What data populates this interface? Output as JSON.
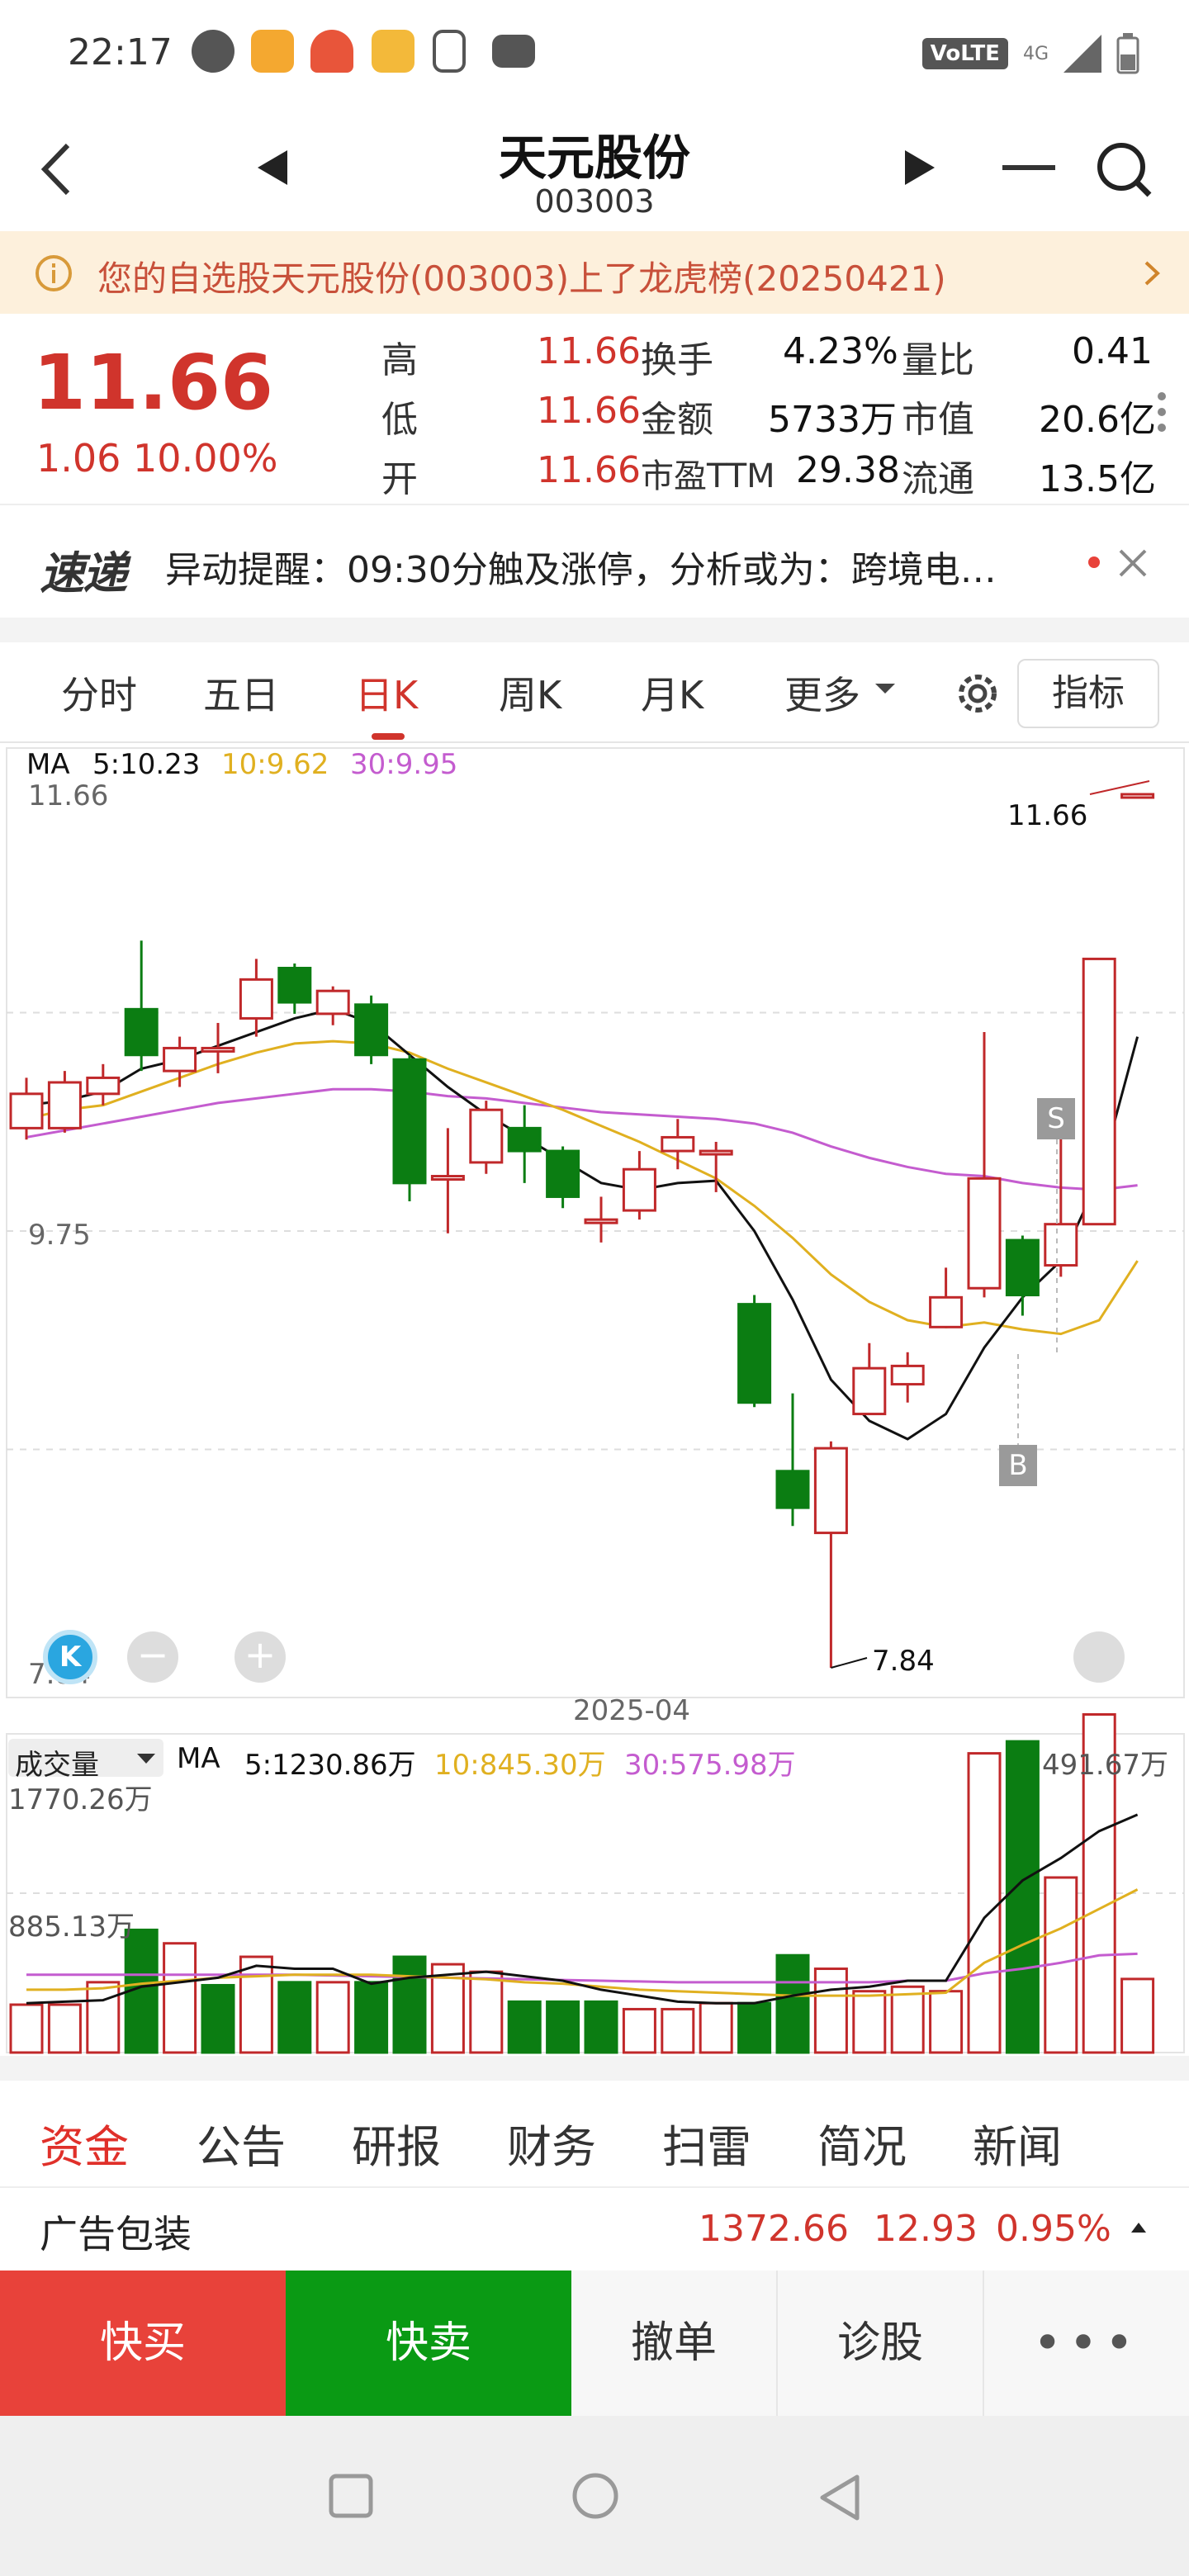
{
  "status_bar": {
    "time": "22:17",
    "network": "4G",
    "volte": "VoLTE"
  },
  "header": {
    "title": "天元股份",
    "code": "003003"
  },
  "notice": {
    "text": "您的自选股天元股份(003003)上了龙虎榜(20250421)"
  },
  "quote": {
    "price": "11.66",
    "change": "1.06  10.00%",
    "cells": [
      {
        "label": "高",
        "value": "11.66"
      },
      {
        "label": "低",
        "value": "11.66"
      },
      {
        "label": "开",
        "value": "11.66"
      },
      {
        "label": "换手",
        "value": "4.23%"
      },
      {
        "label": "金额",
        "value": "5733万"
      },
      {
        "label": "市盈TTM",
        "value": "29.38"
      },
      {
        "label": "量比",
        "value": "0.41"
      },
      {
        "label": "市值",
        "value": "20.6亿"
      },
      {
        "label": "流通",
        "value": "13.5亿"
      }
    ]
  },
  "alert": {
    "logo": "速递",
    "message": "异动提醒：09:30分触及涨停，分析或为：跨境电…"
  },
  "tabs": [
    {
      "label": "分时"
    },
    {
      "label": "五日"
    },
    {
      "label": "日K"
    },
    {
      "label": "周K"
    },
    {
      "label": "月K"
    },
    {
      "label": "更多"
    }
  ],
  "indicator_button": "指标",
  "kline": {
    "ma_label": "MA",
    "ma5": "5:10.23",
    "ma10": "10:9.62",
    "ma30": "30:9.95",
    "y_top": "11.66",
    "y_mid": "9.75",
    "y_bottom": "7.84",
    "high_marker": "11.66",
    "low_marker": "7.84",
    "date_label": "2025-04",
    "sell_tag": "S",
    "buy_tag": "B",
    "colors": {
      "up": "#c0282a",
      "down": "#0b7d12",
      "ma5": "#111111",
      "ma10": "#e0b020",
      "ma30": "#c45ccf"
    }
  },
  "volume": {
    "label": "成交量",
    "ma_label": "MA",
    "ma5": "5:1230.86万",
    "ma10": "10:845.30万",
    "ma30": "30:575.98万",
    "last": "491.67万",
    "y_top": "1770.26万",
    "y_mid": "885.13万"
  },
  "bottom_tabs": [
    {
      "label": "资金"
    },
    {
      "label": "公告"
    },
    {
      "label": "研报"
    },
    {
      "label": "财务"
    },
    {
      "label": "扫雷"
    },
    {
      "label": "简况"
    },
    {
      "label": "新闻"
    }
  ],
  "sector": {
    "name": "广告包装",
    "index": "1372.66",
    "change": "12.93",
    "pct": "0.95%"
  },
  "actions": {
    "buy": "快买",
    "sell": "快卖",
    "cancel": "撤单",
    "diagnose": "诊股",
    "more": "•••"
  },
  "chart_data": {
    "type": "candlestick",
    "price_range": [
      7.84,
      11.66
    ],
    "candles": [
      {
        "o": 10.2,
        "c": 10.35,
        "h": 10.42,
        "l": 10.15
      },
      {
        "o": 10.2,
        "c": 10.4,
        "h": 10.45,
        "l": 10.18
      },
      {
        "o": 10.35,
        "c": 10.42,
        "h": 10.48,
        "l": 10.3
      },
      {
        "o": 10.72,
        "c": 10.52,
        "h": 11.02,
        "l": 10.45
      },
      {
        "o": 10.45,
        "c": 10.55,
        "h": 10.6,
        "l": 10.38
      },
      {
        "o": 10.55,
        "c": 10.55,
        "h": 10.66,
        "l": 10.44
      },
      {
        "o": 10.68,
        "c": 10.85,
        "h": 10.94,
        "l": 10.6
      },
      {
        "o": 10.9,
        "c": 10.75,
        "h": 10.92,
        "l": 10.7
      },
      {
        "o": 10.7,
        "c": 10.8,
        "h": 10.82,
        "l": 10.65
      },
      {
        "o": 10.74,
        "c": 10.52,
        "h": 10.78,
        "l": 10.48
      },
      {
        "o": 10.5,
        "c": 9.96,
        "h": 10.52,
        "l": 9.88
      },
      {
        "o": 9.98,
        "c": 9.99,
        "h": 10.2,
        "l": 9.74
      },
      {
        "o": 10.05,
        "c": 10.28,
        "h": 10.32,
        "l": 10.0
      },
      {
        "o": 10.2,
        "c": 10.1,
        "h": 10.3,
        "l": 9.96
      },
      {
        "o": 10.1,
        "c": 9.9,
        "h": 10.12,
        "l": 9.85
      },
      {
        "o": 9.8,
        "c": 9.8,
        "h": 9.9,
        "l": 9.7
      },
      {
        "o": 9.84,
        "c": 10.02,
        "h": 10.1,
        "l": 9.8
      },
      {
        "o": 10.1,
        "c": 10.16,
        "h": 10.24,
        "l": 10.02
      },
      {
        "o": 10.1,
        "c": 10.1,
        "h": 10.14,
        "l": 9.92
      },
      {
        "o": 9.43,
        "c": 9.0,
        "h": 9.47,
        "l": 8.98
      },
      {
        "o": 8.7,
        "c": 8.54,
        "h": 9.04,
        "l": 8.46
      },
      {
        "o": 8.43,
        "c": 8.8,
        "h": 8.83,
        "l": 7.84
      },
      {
        "o": 8.95,
        "c": 9.15,
        "h": 9.26,
        "l": 8.95
      },
      {
        "o": 9.08,
        "c": 9.16,
        "h": 9.22,
        "l": 9.0
      },
      {
        "o": 9.33,
        "c": 9.46,
        "h": 9.59,
        "l": 9.33
      },
      {
        "o": 9.5,
        "c": 9.98,
        "h": 10.62,
        "l": 9.46
      },
      {
        "o": 9.71,
        "c": 9.47,
        "h": 9.73,
        "l": 9.38
      },
      {
        "o": 9.6,
        "c": 9.78,
        "h": 10.18,
        "l": 9.55
      },
      {
        "o": 9.78,
        "c": 10.94,
        "h": 10.94,
        "l": 9.78
      },
      {
        "o": 11.66,
        "c": 11.66,
        "h": 11.66,
        "l": 11.66
      }
    ],
    "ma5": [
      10.3,
      10.32,
      10.36,
      10.46,
      10.5,
      10.56,
      10.62,
      10.68,
      10.72,
      10.66,
      10.52,
      10.38,
      10.26,
      10.16,
      10.06,
      9.96,
      9.93,
      9.96,
      9.97,
      9.75,
      9.45,
      9.1,
      8.92,
      8.84,
      8.95,
      9.24,
      9.46,
      9.62,
      9.98,
      10.6
    ],
    "ma10": [
      10.24,
      10.28,
      10.3,
      10.36,
      10.42,
      10.48,
      10.53,
      10.57,
      10.58,
      10.57,
      10.53,
      10.46,
      10.4,
      10.34,
      10.28,
      10.21,
      10.14,
      10.06,
      9.98,
      9.86,
      9.72,
      9.56,
      9.44,
      9.36,
      9.33,
      9.35,
      9.32,
      9.3,
      9.36,
      9.62
    ],
    "ma30": [
      10.16,
      10.19,
      10.22,
      10.25,
      10.28,
      10.31,
      10.33,
      10.35,
      10.37,
      10.37,
      10.36,
      10.34,
      10.33,
      10.31,
      10.29,
      10.27,
      10.26,
      10.25,
      10.24,
      10.22,
      10.18,
      10.12,
      10.07,
      10.03,
      10.0,
      9.99,
      9.96,
      9.94,
      9.93,
      9.95
    ],
    "volume_range": [
      0,
      1770.26
    ],
    "volume": [
      320,
      320,
      470,
      820,
      730,
      450,
      640,
      470,
      470,
      470,
      640,
      590,
      540,
      340,
      340,
      340,
      290,
      290,
      330,
      330,
      650,
      560,
      410,
      440,
      410,
      2000,
      2080,
      1170,
      2260,
      491.67
    ],
    "volume_up": [
      true,
      true,
      true,
      false,
      true,
      false,
      true,
      false,
      true,
      false,
      false,
      true,
      true,
      false,
      false,
      false,
      true,
      true,
      true,
      false,
      false,
      true,
      true,
      true,
      true,
      true,
      false,
      true,
      true,
      true
    ],
    "vol_ma5": [
      330,
      340,
      350,
      440,
      470,
      500,
      580,
      560,
      560,
      460,
      500,
      520,
      540,
      510,
      480,
      420,
      380,
      340,
      330,
      330,
      380,
      420,
      440,
      480,
      480,
      900,
      1150,
      1300,
      1480,
      1590
    ],
    "vol_ma10": [
      420,
      420,
      430,
      460,
      480,
      500,
      510,
      520,
      520,
      520,
      510,
      500,
      490,
      470,
      460,
      440,
      420,
      410,
      400,
      390,
      380,
      380,
      380,
      390,
      400,
      600,
      720,
      830,
      960,
      1090
    ],
    "vol_ma30": [
      520,
      520,
      520,
      520,
      520,
      520,
      520,
      520,
      515,
      510,
      505,
      500,
      495,
      490,
      485,
      480,
      475,
      470,
      470,
      470,
      470,
      470,
      470,
      480,
      480,
      530,
      560,
      600,
      650,
      660
    ]
  }
}
